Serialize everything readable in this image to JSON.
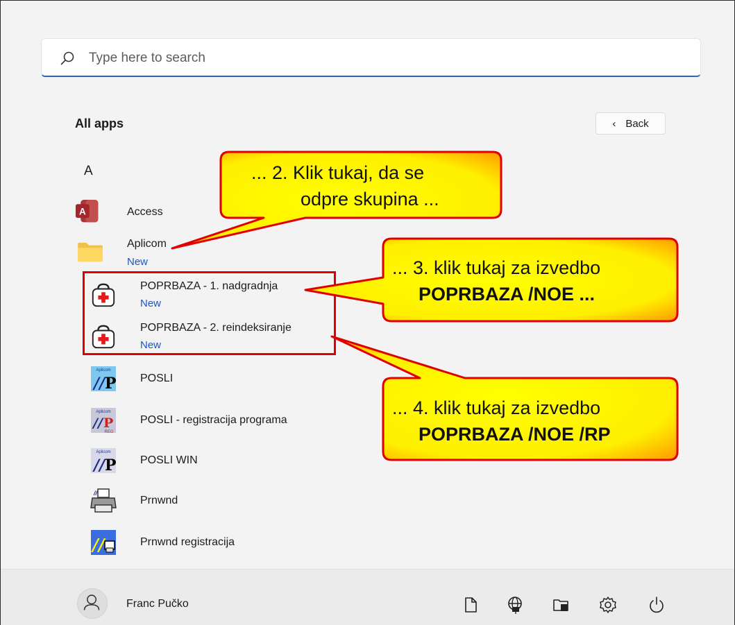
{
  "search": {
    "placeholder": "Type here to search"
  },
  "header": {
    "title": "All apps",
    "back_label": "Back"
  },
  "group_letter": "A",
  "apps": [
    {
      "name": "Access",
      "new": ""
    },
    {
      "name": "Aplicom",
      "new": "New"
    },
    {
      "name": "POPRBAZA - 1. nadgradnja",
      "new": "New"
    },
    {
      "name": "POPRBAZA - 2. reindeksiranje",
      "new": "New"
    },
    {
      "name": "POSLI",
      "new": ""
    },
    {
      "name": "POSLI - registracija programa",
      "new": ""
    },
    {
      "name": "POSLI WIN",
      "new": ""
    },
    {
      "name": "Prnwnd",
      "new": ""
    },
    {
      "name": "Prnwnd registracija",
      "new": ""
    }
  ],
  "icon_texts": {
    "aplicom": "Aplicom",
    "reg": "REG"
  },
  "callouts": {
    "c2": {
      "line1": "... 2. Klik tukaj, da se",
      "line2": "odpre skupina ..."
    },
    "c3": {
      "line1": "... 3. klik tukaj za izvedbo",
      "line2": "POPRBAZA /NOE ..."
    },
    "c4": {
      "line1": "... 4. klik tukaj za izvedbo",
      "line2": "POPRBAZA /NOE /RP"
    }
  },
  "footer": {
    "user_name": "Franc Pučko",
    "icons": [
      "document-icon",
      "network-icon",
      "file-explorer-icon",
      "settings-icon",
      "power-icon"
    ]
  },
  "colors": {
    "accent": "#2a64b8",
    "new_text": "#1a56c4",
    "callout_fill": "#ffff00",
    "callout_border": "#e00000"
  }
}
